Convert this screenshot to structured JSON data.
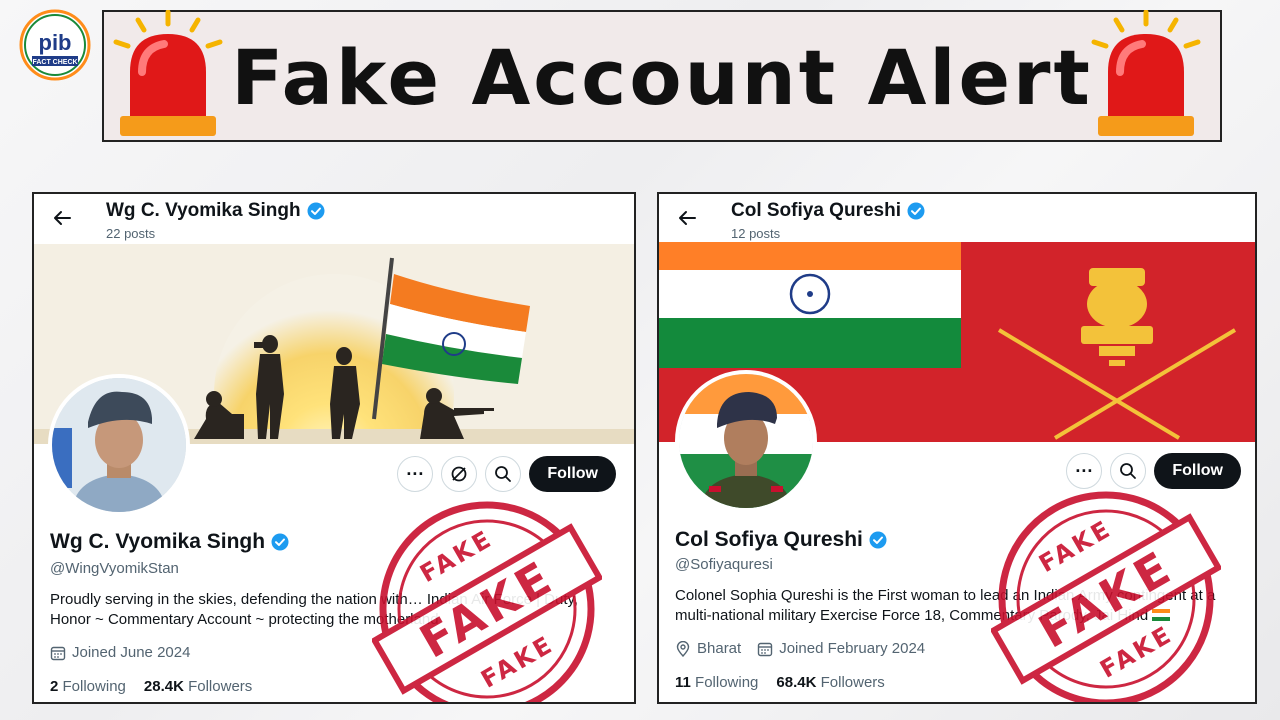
{
  "header": {
    "title": "Fake Account Alert",
    "logo_text": "pib",
    "logo_subtext": "FACT CHECK"
  },
  "colors": {
    "alert_red": "#d42a2a",
    "verified_blue": "#1d9bf0",
    "stamp_red": "#c8102e",
    "saffron": "#ff8c1a",
    "india_green": "#1a8a3a"
  },
  "stamp_text": "FAKE",
  "profiles": [
    {
      "top_name": "Wg C. Vyomika Singh",
      "posts": "22 posts",
      "name": "Wg C. Vyomika Singh",
      "handle": "@WingVyomikStan",
      "bio": "Proudly serving in the skies, defending the nation with… Indian Air Force | Duty, Honor ~ Commentary Account ~ protecting the motherland",
      "joined": "Joined June 2024",
      "following_count": "2",
      "following_label": "Following",
      "followers_count": "28.4K",
      "followers_label": "Followers",
      "follow_label": "Follow",
      "more_label": "···"
    },
    {
      "top_name": "Col Sofiya Qureshi",
      "posts": "12 posts",
      "name": "Col Sofiya Qureshi",
      "handle": "@Sofiyaquresi",
      "bio": "Colonel Sophia Qureshi is the First woman to lead an Indian Army contingent at a multi-national military Exercise Force 18, Commentary Parody, Jai Hind",
      "location": "Bharat",
      "joined": "Joined February 2024",
      "following_count": "11",
      "following_label": "Following",
      "followers_count": "68.4K",
      "followers_label": "Followers",
      "follow_label": "Follow",
      "more_label": "···"
    }
  ]
}
